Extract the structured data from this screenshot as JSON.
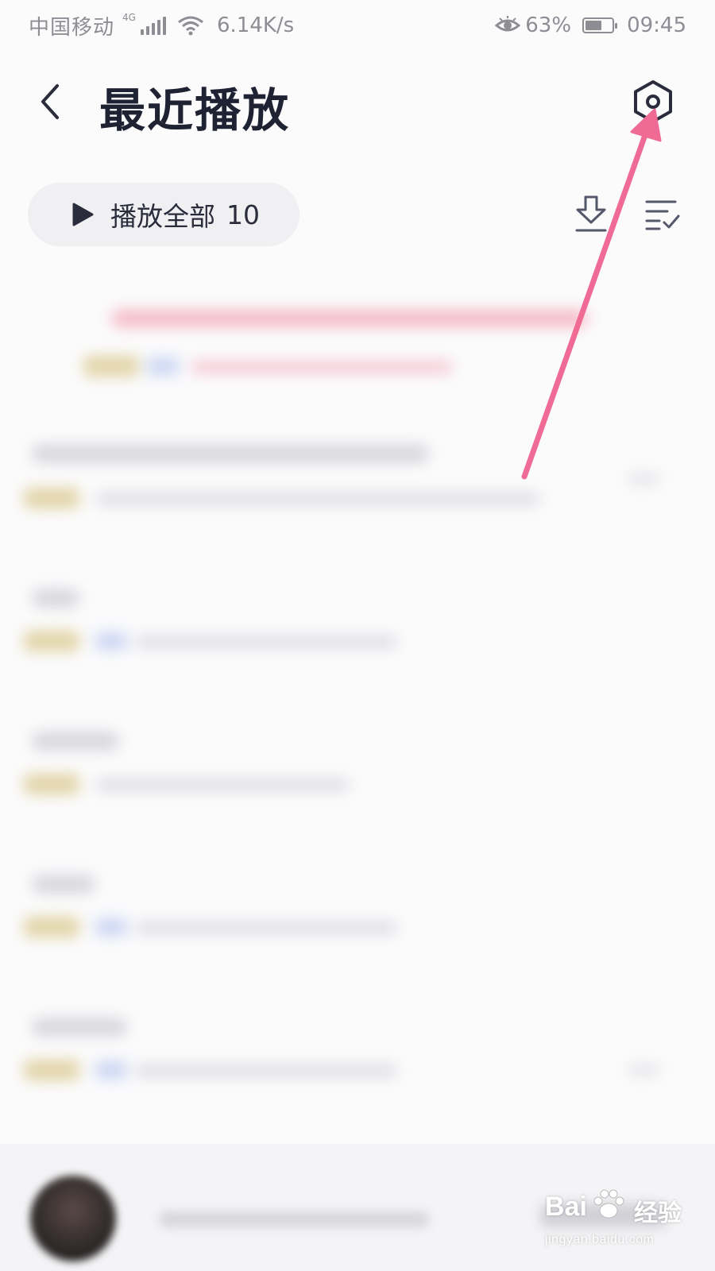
{
  "status_bar": {
    "carrier": "中国移动",
    "network_type": "4G",
    "net_speed": "6.14K/s",
    "battery_percent": "63%",
    "battery_level": 0.63,
    "time": "09:45",
    "icons": [
      "signal-icon",
      "wifi-icon",
      "eye-icon",
      "battery-icon"
    ]
  },
  "header": {
    "title": "最近播放",
    "back_icon": "chevron-left-icon",
    "settings_icon": "settings-hexagon-icon"
  },
  "actions": {
    "play_all_label": "播放全部",
    "play_all_count": "10",
    "download_icon": "download-icon",
    "multi_select_icon": "multi-select-icon"
  },
  "colors": {
    "title": "#1f2233",
    "status_text": "#8d8e94",
    "pill_background": "#f0f0f3",
    "annotation_arrow": "#f06a96"
  },
  "watermark": {
    "logo_text": "Bai",
    "logo_text_cn": "经验",
    "url": "jingyan.baidu.com"
  }
}
